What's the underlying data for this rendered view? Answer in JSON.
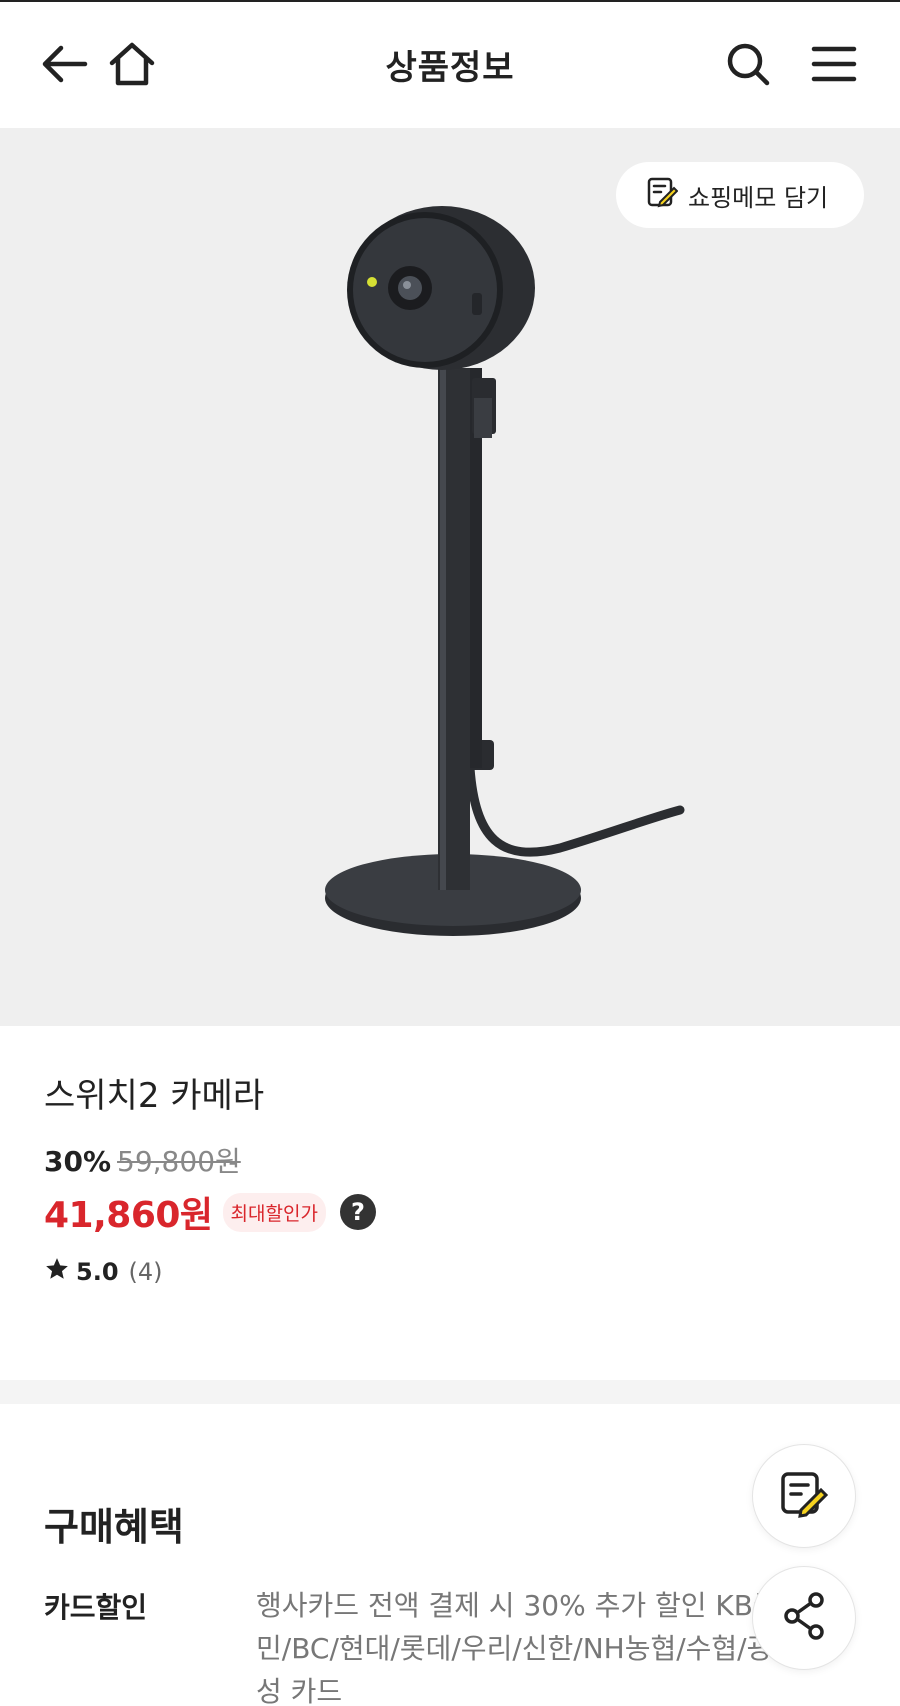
{
  "header": {
    "title": "상품정보",
    "back_icon": "back-arrow-icon",
    "home_icon": "home-icon",
    "search_icon": "search-icon",
    "menu_icon": "hamburger-menu-icon"
  },
  "hero": {
    "memo_button_label": "쇼핑메모 담기",
    "memo_icon": "memo-pencil-icon"
  },
  "product": {
    "name": "스위치2 카메라",
    "discount_rate": "30%",
    "original_price": "59,800원",
    "sale_price": "41,860원",
    "max_discount_badge": "최대할인가",
    "help_icon": "?",
    "rating": "5.0",
    "review_count": "(4)"
  },
  "benefits": {
    "title": "구매혜택",
    "card_discount_label": "카드할인",
    "card_discount_desc": "행사카드 전액 결제 시 30% 추가 할인 KB국민/BC/현대/롯데/우리/신한/NH농협/수협/광주/삼성 카드"
  },
  "floating": {
    "memo_icon": "memo-pencil-icon",
    "share_icon": "share-icon"
  },
  "colors": {
    "accent_red": "#d9262c",
    "highlight_yellow": "#f5d21f",
    "hero_bg": "#efefef"
  }
}
